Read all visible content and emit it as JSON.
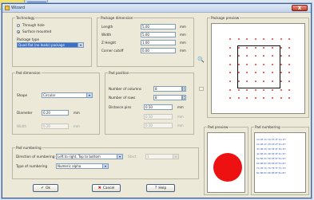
{
  "window": {
    "title": "Wizard",
    "close_glyph": "X"
  },
  "technology": {
    "group_label": "Technology",
    "options": [
      {
        "label": "Through hole",
        "selected": false
      },
      {
        "label": "Surface mounted",
        "selected": true
      }
    ],
    "package_type_label": "Package type",
    "package_type_value": "Quad flat (no leads) package"
  },
  "package_dimension": {
    "group_label": "Package dimension",
    "fields": [
      {
        "label": "Length",
        "value": "5.00",
        "unit": "mm"
      },
      {
        "label": "Width",
        "value": "5.00",
        "unit": "mm"
      },
      {
        "label": "Z Height",
        "value": "1.00",
        "unit": "mm"
      },
      {
        "label": "Corner cutoff",
        "value": "0.00",
        "unit": "mm"
      }
    ]
  },
  "pad_dimension": {
    "group_label": "Pad dimension",
    "shape_label": "Shape",
    "shape_value": "Circular",
    "diameter_label": "Diameter",
    "diameter_value": "0.20",
    "diameter_unit": "mm",
    "disabled_label": "Width",
    "disabled_value": "0.20",
    "disabled_unit": "mm"
  },
  "pad_position": {
    "group_label": "Pad position",
    "fields": [
      {
        "label": "Number of columns",
        "value": "8"
      },
      {
        "label": "Number of rows",
        "value": "8"
      },
      {
        "label": "Distance pins",
        "value": "0.50",
        "unit": "mm"
      }
    ],
    "disabled_rows": [
      {
        "value": "0.50",
        "unit": "mm"
      },
      {
        "value": "0.50",
        "unit": "mm"
      }
    ]
  },
  "pad_numbering": {
    "group_label": "Pad numbering",
    "direction_label": "Direction of numbering",
    "direction_value": "Left to right, Top to bottom",
    "type_label": "Type of numbering",
    "type_value": "Numeric alpha",
    "disabled_label": "Start",
    "disabled_value": "1"
  },
  "previews": {
    "package_preview_label": "Package preview",
    "pad_preview_label": "Pad preview",
    "pad_numbering_label": "Pad numbering",
    "zoom_glyph": "🔍",
    "pad_color": "#ee1111",
    "dot_color": "#e23a3a",
    "numbering_lines": [
      "1A 1B 1C 1D 1E 1F 1G 1H",
      "2A 2B 2C 2D 2E 2F 2G 2H",
      "3A 3B 3C 3D 3E 3F 3G 3H",
      "4A 4B 4C 4D 4E 4F 4G 4H",
      "5A 5B 5C 5D 5E 5F 5G 5H",
      "6A 6B 6C 6D 6E 6F 6G 6H",
      "7A 7B 7C 7D 7E 7F 7G 7H",
      "8A 8B 8C 8D 8E 8F 8G 8H"
    ]
  },
  "buttons": {
    "ok_label": "Ok",
    "ok_icon": "✔",
    "cancel_label": "Cancel",
    "cancel_icon": "✖",
    "help_label": "Help",
    "help_icon": "?"
  }
}
